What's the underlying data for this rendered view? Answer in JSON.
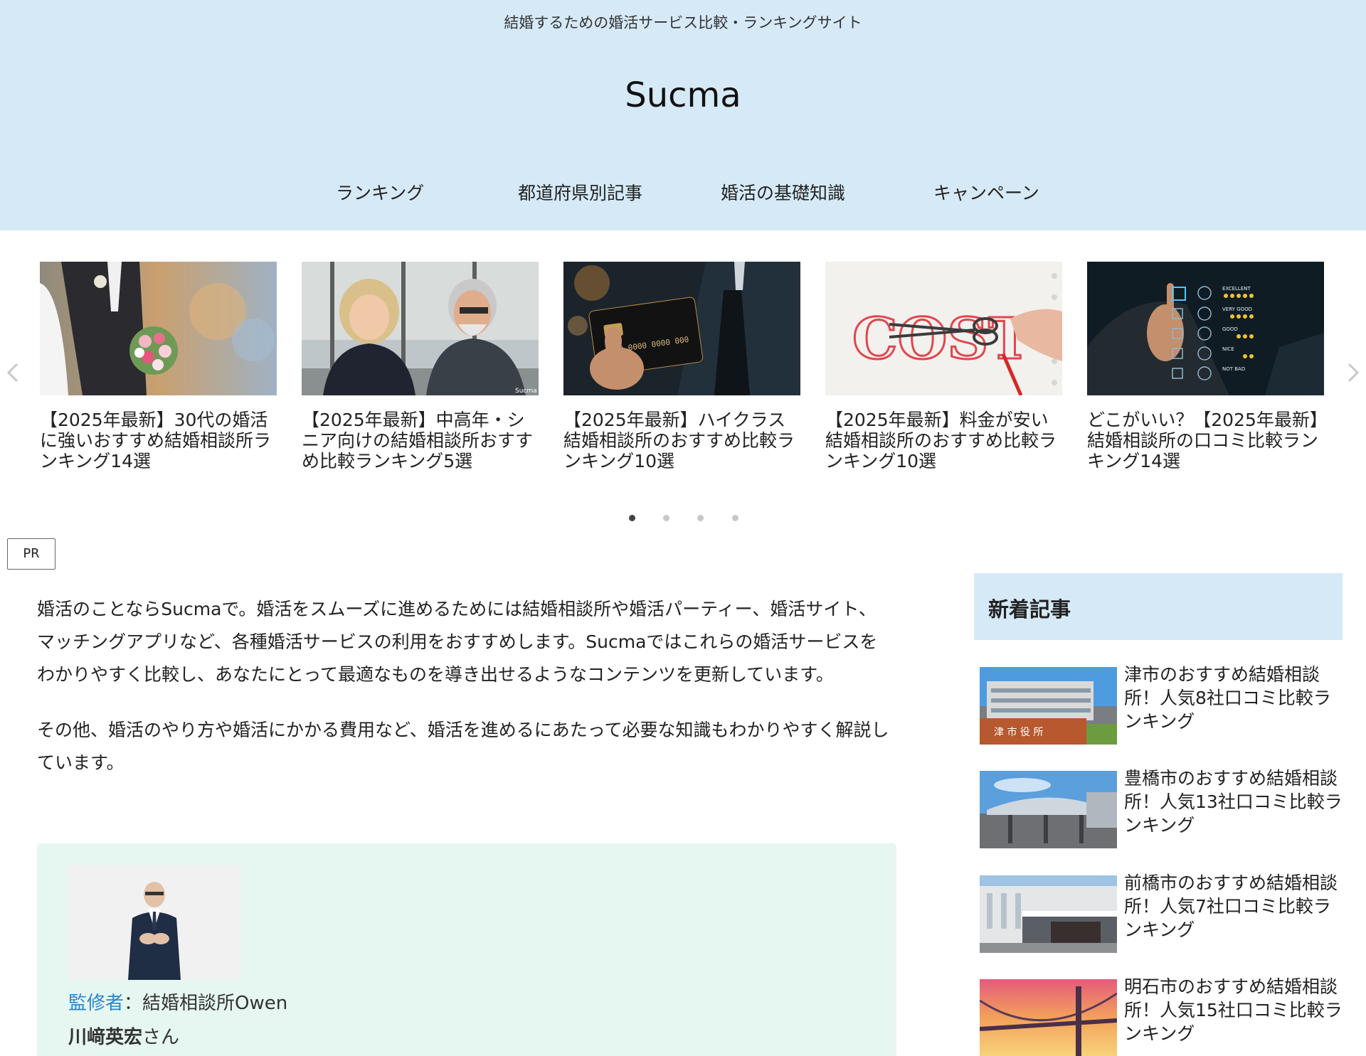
{
  "header": {
    "tagline": "結婚するための婚活サービス比較・ランキングサイト",
    "logo": "Sucma",
    "nav": [
      "ランキング",
      "都道府県別記事",
      "婚活の基礎知識",
      "キャンペーン"
    ]
  },
  "carousel": {
    "slides": [
      {
        "title": "【2025年最新】30代の婚活に強いおすすめ結婚相談所ランキング14選"
      },
      {
        "title": "【2025年最新】中高年・シニア向けの結婚相談所おすすめ比較ランキング5選"
      },
      {
        "title": "【2025年最新】ハイクラス結婚相談所のおすすめ比較ランキング10選"
      },
      {
        "title": "【2025年最新】料金が安い結婚相談所のおすすめ比較ランキング10選"
      },
      {
        "title": "どこがいい？【2025年最新】結婚相談所の口コミ比較ランキング14選"
      }
    ],
    "dots_total": 4,
    "active_dot": 1,
    "image_texts": {
      "card_number": "0000 0000 0000 000",
      "cost": "COST",
      "watermark": "Sucma",
      "ratings": [
        "EXCELLENT",
        "VERY GOOD",
        "GOOD",
        "NICE",
        "NOT BAD"
      ],
      "station_sign": "津 市 役 所"
    }
  },
  "pr_badge": "PR",
  "intro": {
    "p1": "婚活のことならSucmaで。婚活をスムーズに進めるためには結婚相談所や婚活パーティー、婚活サイト、マッチングアプリなど、各種婚活サービスの利用をおすすめします。Sucmaではこれらの婚活サービスをわかりやすく比較し、あなたにとって最適なものを導き出せるようなコンテンツを更新しています。",
    "p2": "その他、婚活のやり方や婚活にかかる費用など、婚活を進めるにあたって必要な知識もわかりやすく解説しています。"
  },
  "supervisor": {
    "role_label": "監修者",
    "separator": "：",
    "org": "結婚相談所Owen",
    "name": "川﨑英宏",
    "suffix": "さん"
  },
  "sidebar": {
    "heading": "新着記事",
    "items": [
      {
        "title": "津市のおすすめ結婚相談所！人気8社口コミ比較ランキング"
      },
      {
        "title": "豊橋市のおすすめ結婚相談所！人気13社口コミ比較ランキング"
      },
      {
        "title": "前橋市のおすすめ結婚相談所！人気7社口コミ比較ランキング"
      },
      {
        "title": "明石市のおすすめ結婚相談所！人気15社口コミ比較ランキング"
      }
    ]
  },
  "colors": {
    "header_bg": "#d6e9f7",
    "supervisor_bg": "#e6f6f1",
    "supervisor_role": "#2a86c8",
    "dot_active": "#444444",
    "dot_inactive": "#c8c8c8"
  }
}
